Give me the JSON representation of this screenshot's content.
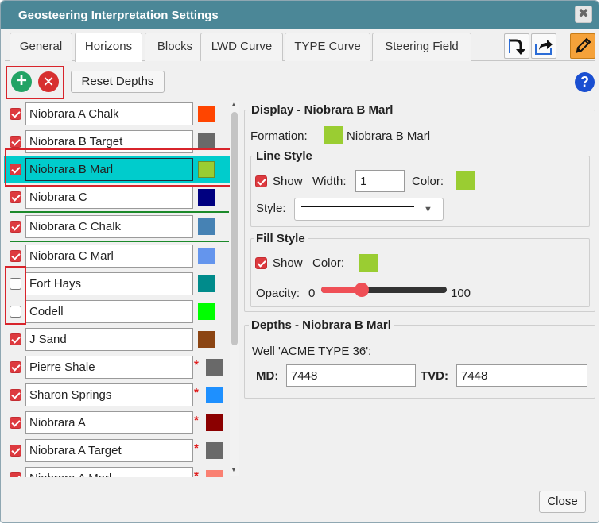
{
  "window": {
    "title": "Geosteering Interpretation Settings",
    "close_glyph": "✖"
  },
  "tabs": [
    {
      "label": "General",
      "active": false
    },
    {
      "label": "Horizons",
      "active": true
    },
    {
      "label": "Blocks",
      "active": false
    },
    {
      "label": "LWD Curve",
      "active": false
    },
    {
      "label": "TYPE Curve",
      "active": false
    },
    {
      "label": "Steering Field",
      "active": false
    }
  ],
  "toolbar": {
    "import_icon": "import-arrow-icon",
    "export_icon": "share-export-icon",
    "edit_icon": "pencil-icon",
    "add_icon": "add-circle-icon",
    "remove_icon": "remove-circle-icon",
    "reset_label": "Reset Depths",
    "help_glyph": "?"
  },
  "colors": {
    "title_bar": "#4b8797",
    "selected_row": "#00cccc",
    "checkbox": "#dd3a3f",
    "highlight_frame": "#d8242b",
    "separator": "#1c8a2b"
  },
  "horizons": [
    {
      "name": "Niobrara A Chalk",
      "checked": true,
      "color": "#ff4500",
      "required": false
    },
    {
      "name": "Niobrara B Target",
      "checked": true,
      "color": "#696969",
      "required": false
    },
    {
      "name": "Niobrara B Marl",
      "checked": true,
      "color": "#9acd32",
      "required": false,
      "selected": true
    },
    {
      "name": "Niobrara C",
      "checked": true,
      "color": "#000080",
      "required": false
    },
    {
      "name": "Niobrara C Chalk",
      "checked": true,
      "color": "#4682b4",
      "required": false
    },
    {
      "name": "Niobrara C Marl",
      "checked": true,
      "color": "#6495ed",
      "required": false
    },
    {
      "name": "Fort Hays",
      "checked": false,
      "color": "#008b8b",
      "required": false
    },
    {
      "name": "Codell",
      "checked": false,
      "color": "#00ff00",
      "required": false
    },
    {
      "name": "J Sand",
      "checked": true,
      "color": "#8b4513",
      "required": false
    },
    {
      "name": "Pierre Shale",
      "checked": true,
      "color": "#696969",
      "required": true
    },
    {
      "name": "Sharon Springs",
      "checked": true,
      "color": "#1e90ff",
      "required": true
    },
    {
      "name": "Niobrara A",
      "checked": true,
      "color": "#8b0000",
      "required": true
    },
    {
      "name": "Niobrara A Target",
      "checked": true,
      "color": "#696969",
      "required": true
    },
    {
      "name": "Niobrara A Marl",
      "checked": true,
      "color": "#fa8072",
      "required": true
    }
  ],
  "required_marker": "*",
  "display": {
    "heading": "Display - Niobrara B Marl",
    "formation_label": "Formation:",
    "formation_name": "Niobrara B Marl",
    "formation_color": "#9acd32",
    "line_style": {
      "heading": "Line Style",
      "show_label": "Show",
      "show_checked": true,
      "width_label": "Width:",
      "width_value": "1",
      "color_label": "Color:",
      "color": "#9acd32",
      "style_label": "Style:"
    },
    "fill_style": {
      "heading": "Fill Style",
      "show_label": "Show",
      "show_checked": true,
      "color_label": "Color:",
      "color": "#9acd32",
      "opacity_label": "Opacity:",
      "opacity_min": "0",
      "opacity_max": "100",
      "opacity_value": 30
    }
  },
  "depths": {
    "heading": "Depths - Niobrara B Marl",
    "well_label": "Well 'ACME TYPE 36':",
    "md_label": "MD:",
    "md_value": "7448",
    "tvd_label": "TVD:",
    "tvd_value": "7448"
  },
  "footer": {
    "close_label": "Close"
  }
}
